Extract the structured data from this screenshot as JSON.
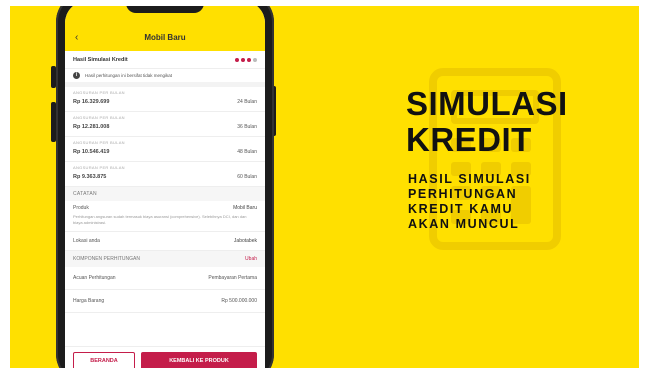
{
  "app": {
    "title": "Mobil Baru",
    "back_icon": "chevron-left-icon"
  },
  "subbar": {
    "label": "Hasil Simulasi Kredit",
    "steps_total": 4,
    "steps_done": 3
  },
  "notice": {
    "text": "Hasil perhitungan ini bersifat tidak mengikat"
  },
  "installments": [
    {
      "label": "ANGSURAN PER BULAN",
      "amount": "Rp 16.329.699",
      "tenor": "24 Bulan"
    },
    {
      "label": "ANGSURAN PER BULAN",
      "amount": "Rp 12.281.008",
      "tenor": "36 Bulan"
    },
    {
      "label": "ANGSURAN PER BULAN",
      "amount": "Rp 10.546.419",
      "tenor": "48 Bulan"
    },
    {
      "label": "ANGSURAN PER BULAN",
      "amount": "Rp 9.363.875",
      "tenor": "60 Bulan"
    }
  ],
  "notes": {
    "title": "CATATAN",
    "product_label": "Produk",
    "product_value": "Mobil Baru",
    "description": "Perhitungan angsuran sudah termasuk biaya asuransi (comprehensive). Selebihnya DCI, dan dan biaya administrasi.",
    "location_label": "Lokasi anda",
    "location_value": "Jabotabek"
  },
  "components": {
    "title": "KOMPONEN PERHITUNGAN",
    "edit_label": "Ubah",
    "rows": [
      {
        "label": "Acuan Perhitungan",
        "value": "Pembayaran Pertama"
      },
      {
        "label": "Harga Barang",
        "value": "Rp 500.000.000"
      }
    ]
  },
  "buttons": {
    "home": "BERANDA",
    "back_to_product": "KEMBALI KE PRODUK"
  },
  "promo": {
    "headline": [
      "SIMULASI",
      "KREDIT"
    ],
    "subline": [
      "HASIL SIMULASI",
      "PERHITUNGAN",
      "KREDIT KAMU",
      "AKAN MUNCUL"
    ],
    "background_icon": "calculator-icon"
  },
  "colors": {
    "background": "#FFE000",
    "accent": "#c41d4a",
    "text_dark": "#111111"
  }
}
